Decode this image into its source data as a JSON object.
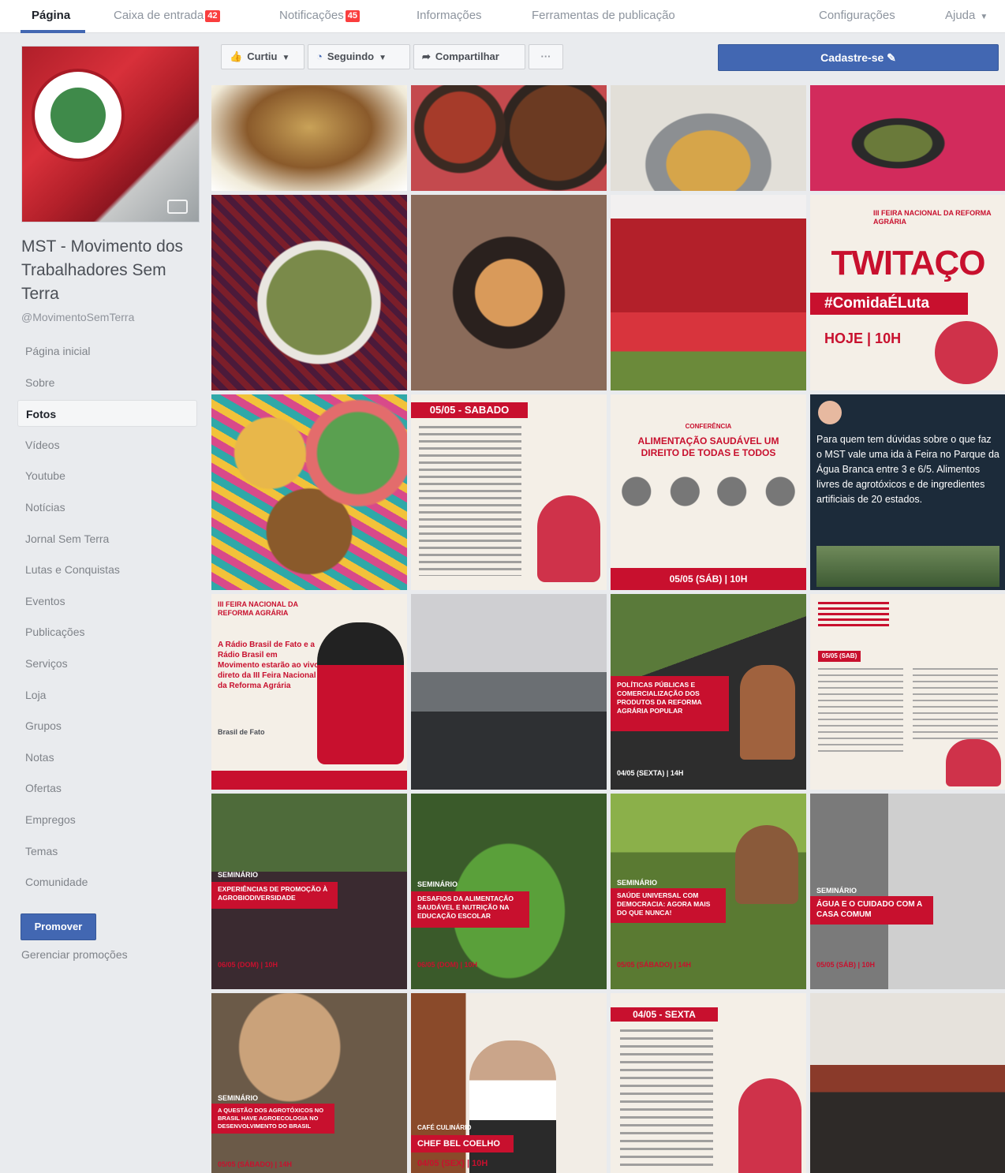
{
  "topnav": {
    "items": [
      {
        "label": "Página",
        "active": true
      },
      {
        "label": "Caixa de entrada",
        "badge": "42"
      },
      {
        "label": "Notificações",
        "badge": "45"
      },
      {
        "label": "Informações"
      },
      {
        "label": "Ferramentas de publicação"
      },
      {
        "label": "Configurações"
      },
      {
        "label": "Ajuda"
      }
    ]
  },
  "sidebar": {
    "page_title": "MST - Movimento dos Trabalhadores Sem Terra",
    "handle": "@MovimentoSemTerra",
    "nav": [
      "Página inicial",
      "Sobre",
      "Fotos",
      "Vídeos",
      "Youtube",
      "Notícias",
      "Jornal Sem Terra",
      "Lutas e Conquistas",
      "Eventos",
      "Publicações",
      "Serviços",
      "Loja",
      "Grupos",
      "Notas",
      "Ofertas",
      "Empregos",
      "Temas",
      "Comunidade"
    ],
    "promote_label": "Promover",
    "manage_promotions": "Gerenciar promoções"
  },
  "actions": {
    "like": "Curtiu",
    "follow": "Seguindo",
    "share": "Compartilhar",
    "more": "···",
    "signup": "Cadastre-se"
  },
  "photos": {
    "twitaco": {
      "event": "III FEIRA NACIONAL DA REFORMA AGRÁRIA",
      "title": "TWITAÇO",
      "tag": "#ComidaÉLuta",
      "when": "HOJE | 10H"
    },
    "schedule_sat": {
      "date": "05/05 - SABADO"
    },
    "conference": {
      "kicker": "CONFERÊNCIA",
      "title": "ALIMENTAÇÃO SAUDÁVEL UM DIREITO DE TODAS E TODOS",
      "footer": "05/05 (SÁB) | 10H"
    },
    "tweet": {
      "text": "Para quem tem dúvidas sobre o que faz o MST vale uma ida à Feira no Parque da Água Branca entre 3 e 6/5. Alimentos livres de agrotóxicos e de ingredientes artificiais de 20 estados."
    },
    "radio": {
      "header": "III FEIRA NACIONAL DA REFORMA AGRÁRIA",
      "text": "A Rádio Brasil de Fato e a Rádio Brasil em Movimento estarão ao vivo direto da III Feira Nacional da Reforma Agrária",
      "brand": "Brasil de Fato"
    },
    "politicas": {
      "title": "POLÍTICAS PÚBLICAS E COMERCIALIZAÇÃO DOS PRODUTOS DA REFORMA AGRÁRIA POPULAR",
      "footer": "04/05 (SEXTA) | 14H"
    },
    "schedule_program": {
      "date": "05/05 (SAB)"
    },
    "agrobio": {
      "kicker": "SEMINÁRIO",
      "title": "EXPERIÊNCIAS DE PROMOÇÃO À AGROBIODIVERSIDADE",
      "footer": "06/05 (DOM) | 10H"
    },
    "alimentacao": {
      "kicker": "SEMINÁRIO",
      "title": "DESAFIOS DA ALIMENTAÇÃO SAUDÁVEL E NUTRIÇÃO NA EDUCAÇÃO ESCOLAR",
      "footer": "06/05 (DOM) | 10H"
    },
    "saude": {
      "kicker": "SEMINÁRIO",
      "title": "SAÚDE UNIVERSAL COM DEMOCRACIA: AGORA MAIS DO QUE NUNCA!",
      "footer": "05/05 (SÁBADO) | 14H"
    },
    "agua": {
      "kicker": "SEMINÁRIO",
      "title": "ÁGUA E O CUIDADO COM A CASA COMUM",
      "footer": "05/05 (SÁB) | 10H"
    },
    "agrotoxicos": {
      "kicker": "SEMINÁRIO",
      "title": "A QUESTÃO DOS AGROTÓXICOS NO BRASIL HAVE AGROECOLOGIA NO DESENVOLVIMENTO DO BRASIL",
      "footer": "05/05 (SÁBADO) | 14H"
    },
    "chef": {
      "kicker": "CAFÉ CULINÁRIO",
      "title": "CHEF BEL COELHO",
      "footer": "04/05 (SEX) | 10H"
    },
    "schedule_fri": {
      "date": "04/05 - SEXTA"
    }
  },
  "colors": {
    "brand": "#4267b2",
    "mst_red": "#c8102e",
    "badge": "#fa3e3e"
  }
}
